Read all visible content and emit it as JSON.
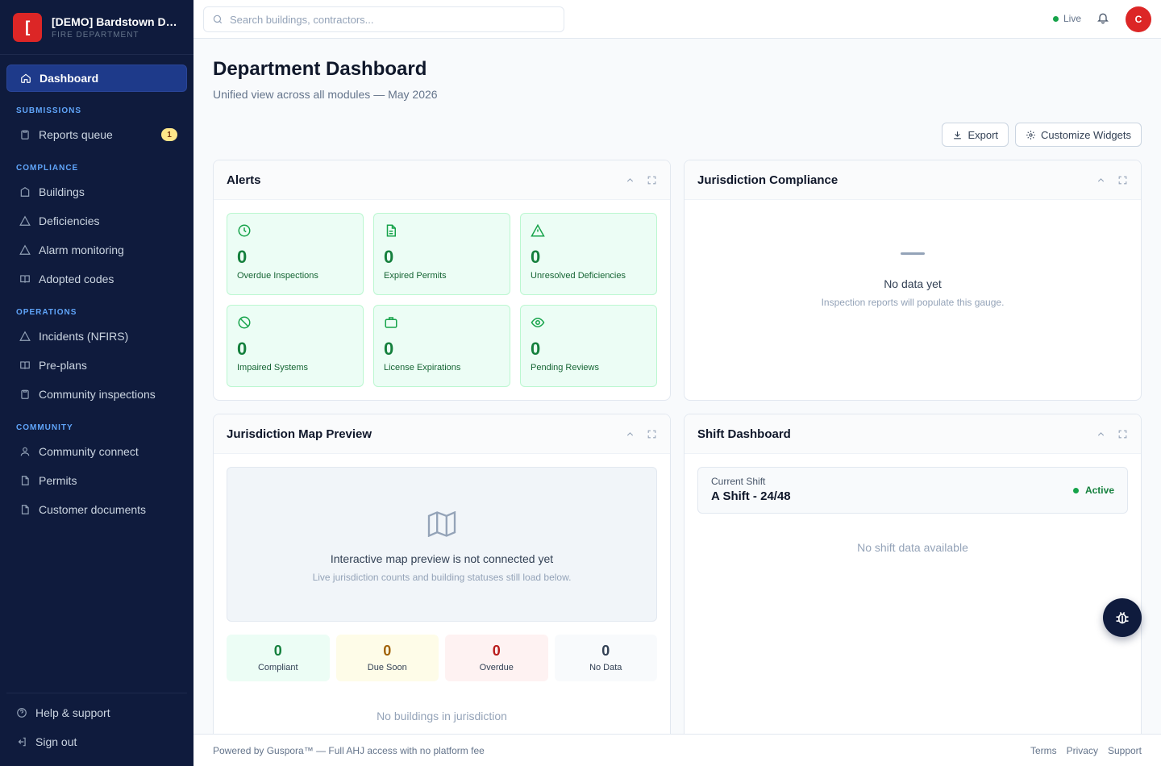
{
  "brand": {
    "logo": "[",
    "name": "[DEMO] Bardstown De...",
    "subtitle": "FIRE DEPARTMENT"
  },
  "nav": {
    "dashboard": "Dashboard",
    "sections": {
      "submissions": "SUBMISSIONS",
      "compliance": "COMPLIANCE",
      "operations": "OPERATIONS",
      "community": "COMMUNITY"
    },
    "items": {
      "reports_queue": "Reports queue",
      "reports_queue_badge": "1",
      "buildings": "Buildings",
      "deficiencies": "Deficiencies",
      "alarm_monitoring": "Alarm monitoring",
      "adopted_codes": "Adopted codes",
      "incidents": "Incidents (NFIRS)",
      "pre_plans": "Pre-plans",
      "community_inspections": "Community inspections",
      "community_connect": "Community connect",
      "permits": "Permits",
      "customer_documents": "Customer documents"
    },
    "bottom": {
      "help": "Help & support",
      "sign_out": "Sign out"
    }
  },
  "topbar": {
    "search_placeholder": "Search buildings, contractors...",
    "live": "Live",
    "avatar": "C"
  },
  "page": {
    "title": "Department Dashboard",
    "subtitle": "Unified view across all modules — May 2026",
    "export": "Export",
    "customize": "Customize Widgets"
  },
  "alerts": {
    "title": "Alerts",
    "tiles": [
      {
        "value": "0",
        "label": "Overdue Inspections",
        "icon": "clock-icon"
      },
      {
        "value": "0",
        "label": "Expired Permits",
        "icon": "file-icon"
      },
      {
        "value": "0",
        "label": "Unresolved Deficiencies",
        "icon": "warning-icon"
      },
      {
        "value": "0",
        "label": "Impaired Systems",
        "icon": "ban-icon"
      },
      {
        "value": "0",
        "label": "License Expirations",
        "icon": "briefcase-icon"
      },
      {
        "value": "0",
        "label": "Pending Reviews",
        "icon": "eye-icon"
      }
    ]
  },
  "compliance": {
    "title": "Jurisdiction Compliance",
    "empty_title": "No data yet",
    "empty_sub": "Inspection reports will populate this gauge."
  },
  "map": {
    "title": "Jurisdiction Map Preview",
    "placeholder_title": "Interactive map preview is not connected yet",
    "placeholder_sub": "Live jurisdiction counts and building statuses still load below.",
    "stats": [
      {
        "value": "0",
        "label": "Compliant",
        "bg": "#ecfdf5",
        "color": "#15803d"
      },
      {
        "value": "0",
        "label": "Due Soon",
        "bg": "#fefce8",
        "color": "#a16207"
      },
      {
        "value": "0",
        "label": "Overdue",
        "bg": "#fef2f2",
        "color": "#b91c1c"
      },
      {
        "value": "0",
        "label": "No Data",
        "bg": "#f8fafc",
        "color": "#334155"
      }
    ],
    "empty": "No buildings in jurisdiction"
  },
  "shift": {
    "title": "Shift Dashboard",
    "current_label": "Current Shift",
    "current_value": "A Shift - 24/48",
    "status": "Active",
    "empty": "No shift data available"
  },
  "footer": {
    "powered": "Powered by Guspora™ — Full AHJ access with no platform fee",
    "terms": "Terms",
    "privacy": "Privacy",
    "support": "Support"
  },
  "colors": {
    "sidebar": "#0f1b3d",
    "accent": "#dc2626",
    "success": "#16a34a"
  }
}
